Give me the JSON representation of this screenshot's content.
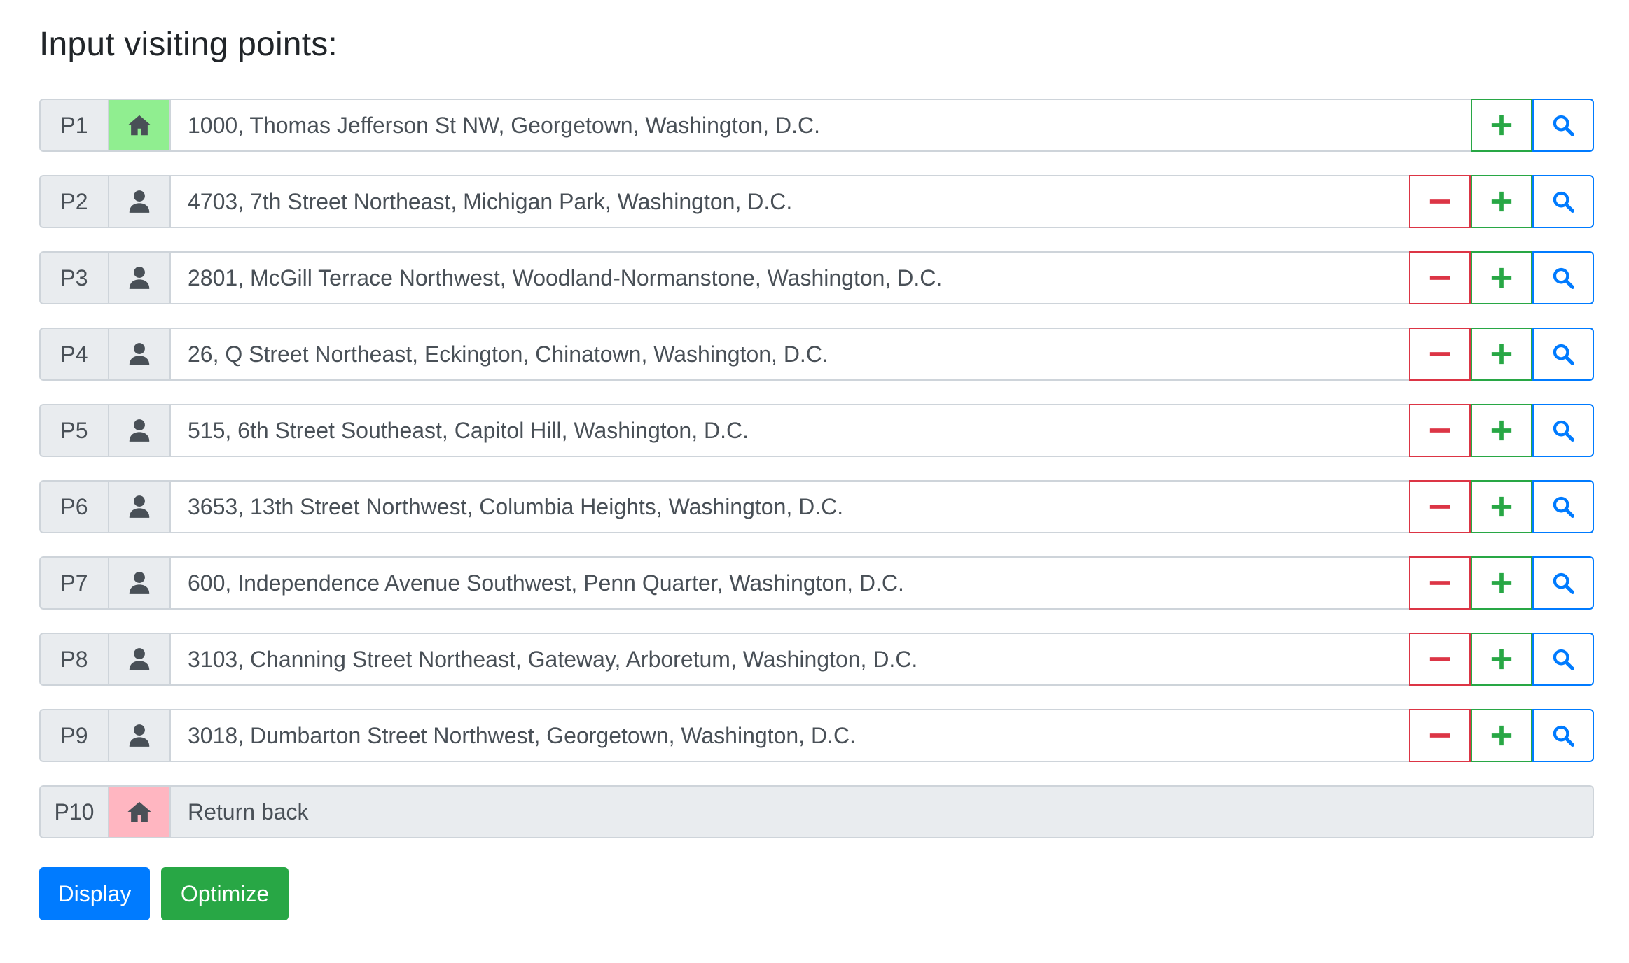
{
  "title": "Input visiting points:",
  "points": [
    {
      "label": "P1",
      "icon": "home-icon",
      "address": "1000, Thomas Jefferson St NW, Georgetown, Washington, D.C."
    },
    {
      "label": "P2",
      "icon": "user-icon",
      "address": "4703, 7th Street Northeast, Michigan Park, Washington, D.C."
    },
    {
      "label": "P3",
      "icon": "user-icon",
      "address": "2801, McGill Terrace Northwest, Woodland-Normanstone, Washington, D.C."
    },
    {
      "label": "P4",
      "icon": "user-icon",
      "address": "26, Q Street Northeast, Eckington, Chinatown, Washington, D.C."
    },
    {
      "label": "P5",
      "icon": "user-icon",
      "address": "515, 6th Street Southeast, Capitol Hill, Washington, D.C."
    },
    {
      "label": "P6",
      "icon": "user-icon",
      "address": "3653, 13th Street Northwest, Columbia Heights, Washington, D.C."
    },
    {
      "label": "P7",
      "icon": "user-icon",
      "address": "600, Independence Avenue Southwest, Penn Quarter, Washington, D.C."
    },
    {
      "label": "P8",
      "icon": "user-icon",
      "address": "3103, Channing Street Northeast, Gateway, Arboretum, Washington, D.C."
    },
    {
      "label": "P9",
      "icon": "user-icon",
      "address": "3018, Dumbarton Street Northwest, Georgetown, Washington, D.C."
    }
  ],
  "return_point": {
    "label": "P10",
    "icon": "home-icon",
    "text": "Return back"
  },
  "buttons": {
    "display": "Display",
    "optimize": "Optimize"
  },
  "colors": {
    "home_start": "#90ee90",
    "home_return": "#ffb6c1",
    "remove": "#dc3545",
    "add": "#28a745",
    "search": "#007bff"
  }
}
